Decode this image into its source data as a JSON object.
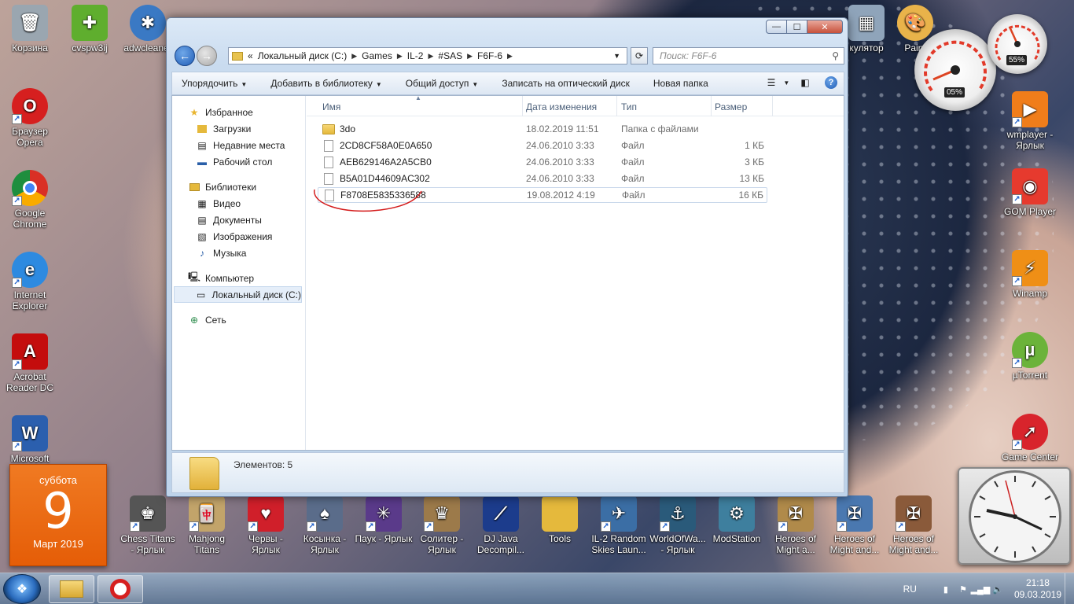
{
  "desktop": {
    "left_icons": [
      {
        "label": "Корзина",
        "icon": "recycle-bin-icon",
        "color": "#9aa6b0"
      },
      {
        "label": "Браузер Opera",
        "icon": "opera-icon",
        "color": "#d61f1f"
      },
      {
        "label": "Google Chrome",
        "icon": "chrome-icon",
        "color": "#2f9b49"
      },
      {
        "label": "Internet Explorer",
        "icon": "ie-icon",
        "color": "#2d8ae0"
      },
      {
        "label": "Acrobat Reader DC",
        "icon": "acrobat-icon",
        "color": "#c40d0d"
      },
      {
        "label": "Microsoft",
        "icon": "word-icon",
        "color": "#2b5fae"
      }
    ],
    "top_icons": [
      {
        "label": "cvspw3ij",
        "icon": "drweb-icon",
        "color": "#5fae2e"
      },
      {
        "label": "adwcleaner",
        "icon": "adwcleaner-icon",
        "color": "#3a79c4"
      },
      {
        "label": "кулятор",
        "icon": "calculator-icon",
        "color": "#8fa4ba"
      },
      {
        "label": "Paint",
        "icon": "paint-icon",
        "color": "#e9b34a"
      }
    ],
    "right_icons": [
      {
        "label": "wmplayer - Ярлык",
        "icon": "media-player-icon",
        "color": "#f07d1a"
      },
      {
        "label": "GOM Player",
        "icon": "gom-player-icon",
        "color": "#e63a2e"
      },
      {
        "label": "Winamp",
        "icon": "winamp-icon",
        "color": "#ef8f16"
      },
      {
        "label": "µTorrent",
        "icon": "utorrent-icon",
        "color": "#6bb33a"
      },
      {
        "label": "Game Center",
        "icon": "game-center-icon",
        "color": "#d8242c"
      }
    ],
    "bottom_icons": [
      {
        "label": "Chess Titans - Ярлык",
        "icon": "chess-icon",
        "color": "#555"
      },
      {
        "label": "Mahjong Titans",
        "icon": "mahjong-icon",
        "color": "#c2a46a"
      },
      {
        "label": "Червы - Ярлык",
        "icon": "hearts-icon",
        "color": "#d01f2a"
      },
      {
        "label": "Косынка - Ярлык",
        "icon": "solitaire-icon",
        "color": "#5a6c8a"
      },
      {
        "label": "Паук - Ярлык",
        "icon": "spider-icon",
        "color": "#5a3a8a"
      },
      {
        "label": "Солитер - Ярлык",
        "icon": "freecell-icon",
        "color": "#9c7a4a"
      },
      {
        "label": "DJ Java Decompil...",
        "icon": "dj-java-icon",
        "color": "#1c3c8c"
      },
      {
        "label": "Tools",
        "icon": "folder-icon",
        "color": "#e5b93c"
      },
      {
        "label": "IL-2 Random Skies Laun...",
        "icon": "il2-icon",
        "color": "#3b6ea5"
      },
      {
        "label": "WorldOfWa... - Ярлык",
        "icon": "wows-icon",
        "color": "#2a5a7a"
      },
      {
        "label": "ModStation",
        "icon": "modstation-icon",
        "color": "#3e7f9e"
      },
      {
        "label": "Heroes of Might a...",
        "icon": "heroes-icon",
        "color": "#b08a4a"
      },
      {
        "label": "Heroes of Might and...",
        "icon": "heroes-icon",
        "color": "#4a78b0"
      },
      {
        "label": "Heroes of Might and...",
        "icon": "heroes-icon",
        "color": "#8a5a3a"
      }
    ]
  },
  "calendar": {
    "weekday": "суббота",
    "day": "9",
    "month_year": "Март 2019"
  },
  "gauges": {
    "cpu_percent": "05%",
    "ram_percent": "55%"
  },
  "explorer": {
    "address": {
      "prefix": "«",
      "segments": [
        "Локальный диск (C:)",
        "Games",
        "IL-2",
        "#SAS",
        "F6F-6"
      ]
    },
    "search_placeholder": "Поиск: F6F-6",
    "toolbar": {
      "organize": "Упорядочить",
      "add_library": "Добавить в библиотеку",
      "share": "Общий доступ",
      "burn": "Записать на оптический диск",
      "new_folder": "Новая папка"
    },
    "nav": {
      "favorites": "Избранное",
      "downloads": "Загрузки",
      "recent": "Недавние места",
      "desktop": "Рабочий стол",
      "libraries": "Библиотеки",
      "video": "Видео",
      "documents": "Документы",
      "images": "Изображения",
      "music": "Музыка",
      "computer": "Компьютер",
      "local_disk": "Локальный диск (C:)",
      "network": "Сеть"
    },
    "columns": {
      "name": "Имя",
      "date": "Дата изменения",
      "type": "Тип",
      "size": "Размер"
    },
    "files": [
      {
        "name": "3do",
        "date": "18.02.2019 11:51",
        "type": "Папка с файлами",
        "size": "",
        "kind": "folder"
      },
      {
        "name": "2CD8CF58A0E0A650",
        "date": "24.06.2010 3:33",
        "type": "Файл",
        "size": "1 КБ",
        "kind": "file"
      },
      {
        "name": "AEB629146A2A5CB0",
        "date": "24.06.2010 3:33",
        "type": "Файл",
        "size": "3 КБ",
        "kind": "file"
      },
      {
        "name": "B5A01D44609AC302",
        "date": "24.06.2010 3:33",
        "type": "Файл",
        "size": "13 КБ",
        "kind": "file"
      },
      {
        "name": "F8708E5835336588",
        "date": "19.08.2012 4:19",
        "type": "Файл",
        "size": "16 КБ",
        "kind": "file"
      }
    ],
    "status": "Элементов: 5"
  },
  "taskbar": {
    "lang": "RU",
    "time": "21:18",
    "date": "09.03.2019"
  }
}
